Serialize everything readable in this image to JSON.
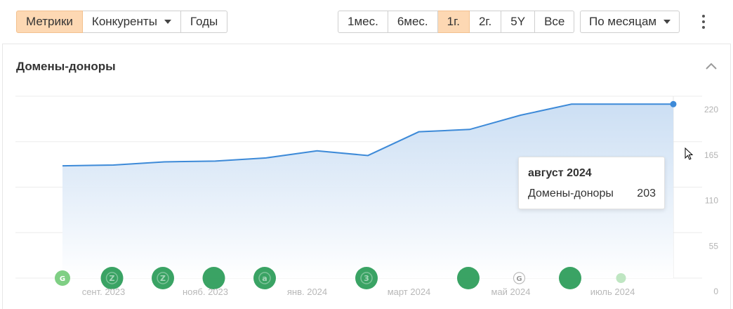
{
  "toolbar": {
    "view_tabs": [
      {
        "label": "Метрики",
        "active": true
      },
      {
        "label": "Конкуренты",
        "active": false,
        "has_caret": true
      },
      {
        "label": "Годы",
        "active": false
      }
    ],
    "period_tabs": [
      {
        "label": "1мес.",
        "active": false
      },
      {
        "label": "6мес.",
        "active": false
      },
      {
        "label": "1г.",
        "active": true
      },
      {
        "label": "2г.",
        "active": false
      },
      {
        "label": "5Y",
        "active": false
      },
      {
        "label": "Все",
        "active": false
      }
    ],
    "granularity": "По месяцам",
    "more_icon": "kebab-vertical-icon"
  },
  "panel": {
    "title": "Домены-доноры",
    "collapse_icon": "chevron-up-icon"
  },
  "tooltip": {
    "title": "август 2024",
    "label": "Домены-доноры",
    "value": "203"
  },
  "colors": {
    "accent": "#fdd8b3",
    "line": "#3d8ad8",
    "area_top": "#c9ddf3",
    "marker_dark": "#2f9e5c",
    "marker_light": "#7fcf84"
  },
  "chart_data": {
    "type": "area",
    "x": [
      "2023-08",
      "2023-09",
      "2023-10",
      "2023-11",
      "2023-12",
      "2024-01",
      "2024-02",
      "2024-03",
      "2024-04",
      "2024-05",
      "2024-06",
      "2024-07",
      "2024-08"
    ],
    "x_tick_labels": [
      "сент. 2023",
      "нояб. 2023",
      "янв. 2024",
      "март 2024",
      "май 2024",
      "июль 2024"
    ],
    "series": [
      {
        "name": "Домены-доноры",
        "values": [
          142,
          143,
          147,
          148,
          152,
          161,
          155,
          185,
          188,
          206,
          220,
          220,
          220
        ]
      }
    ],
    "y_ticks": [
      "220",
      "165",
      "110",
      "55",
      "0"
    ],
    "ylim": [
      0,
      230
    ],
    "grid": true,
    "highlight_index": 12,
    "markers": [
      {
        "x": "2023-08",
        "letter": "G",
        "size": "small",
        "tone": "light"
      },
      {
        "x": "2023-09",
        "letter": "Z",
        "size": "large",
        "tone": "dark"
      },
      {
        "x": "2023-10",
        "letter": "Z",
        "size": "large",
        "tone": "dark"
      },
      {
        "x": "2023-11",
        "letter": "",
        "size": "large",
        "tone": "dark"
      },
      {
        "x": "2023-12",
        "letter": "a",
        "size": "large",
        "tone": "dark"
      },
      {
        "x": "2024-02",
        "letter": "3",
        "size": "large",
        "tone": "dark"
      },
      {
        "x": "2024-04",
        "letter": "",
        "size": "large",
        "tone": "dark"
      },
      {
        "x": "2024-05",
        "letter": "G",
        "size": "small",
        "tone": "outline"
      },
      {
        "x": "2024-06",
        "letter": "",
        "size": "large",
        "tone": "dark"
      },
      {
        "x": "2024-07",
        "letter": "",
        "size": "small",
        "tone": "faint"
      }
    ]
  }
}
